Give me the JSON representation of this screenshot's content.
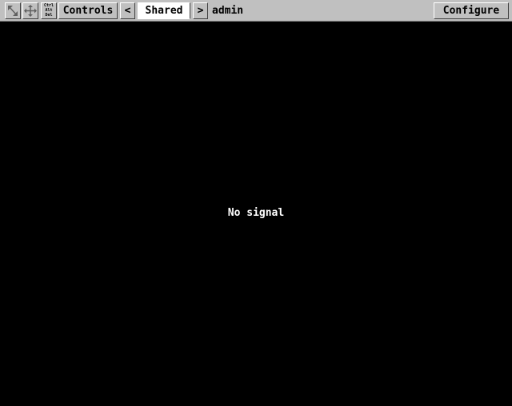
{
  "toolbar": {
    "icons": {
      "fit": "resize-arrow-icon",
      "move": "move-cross-icon",
      "ctrl_alt_del": "ctrl-alt-del-icon"
    },
    "ctrl_alt_del_lines": [
      "Ctrl",
      "Alt",
      "Del"
    ],
    "controls_label": "Controls",
    "prev_label": "<",
    "active_tab_label": "Shared",
    "next_label": ">",
    "user": "admin",
    "configure_label": "Configure"
  },
  "screen": {
    "message": "No signal"
  },
  "colors": {
    "toolbar_bg": "#c0c0c0",
    "screen_bg": "#000000",
    "message_text": "#ffffff"
  }
}
